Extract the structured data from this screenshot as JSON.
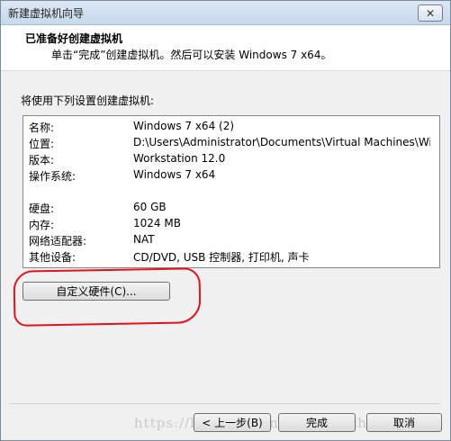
{
  "window": {
    "title": "新建虚拟机向导",
    "close_symbol": "✕"
  },
  "header": {
    "title": "已准备好创建虚拟机",
    "subtitle": "单击“完成”创建虚拟机。然后可以安装 Windows 7 x64。"
  },
  "intro": "将使用下列设置创建虚拟机:",
  "summary": {
    "rows": [
      {
        "label": "名称:",
        "value": "Windows 7 x64 (2)"
      },
      {
        "label": "位置:",
        "value": "D:\\Users\\Administrator\\Documents\\Virtual Machines\\Wind..."
      },
      {
        "label": "版本:",
        "value": "Workstation 12.0"
      },
      {
        "label": "操作系统:",
        "value": "Windows 7 x64"
      },
      {
        "label": "硬盘:",
        "value": "60 GB"
      },
      {
        "label": "内存:",
        "value": "1024 MB"
      },
      {
        "label": "网络适配器:",
        "value": "NAT"
      },
      {
        "label": "其他设备:",
        "value": "CD/DVD, USB 控制器, 打印机, 声卡"
      }
    ]
  },
  "buttons": {
    "customize": "自定义硬件(C)...",
    "back": "< 上一步(B)",
    "finish": "完成",
    "cancel": "取消"
  },
  "watermark": "https://blog.csdn.net/ygdxt_zhaoace",
  "colors": {
    "annotation": "#e0141c",
    "titlebar": "#c7d9ec"
  }
}
